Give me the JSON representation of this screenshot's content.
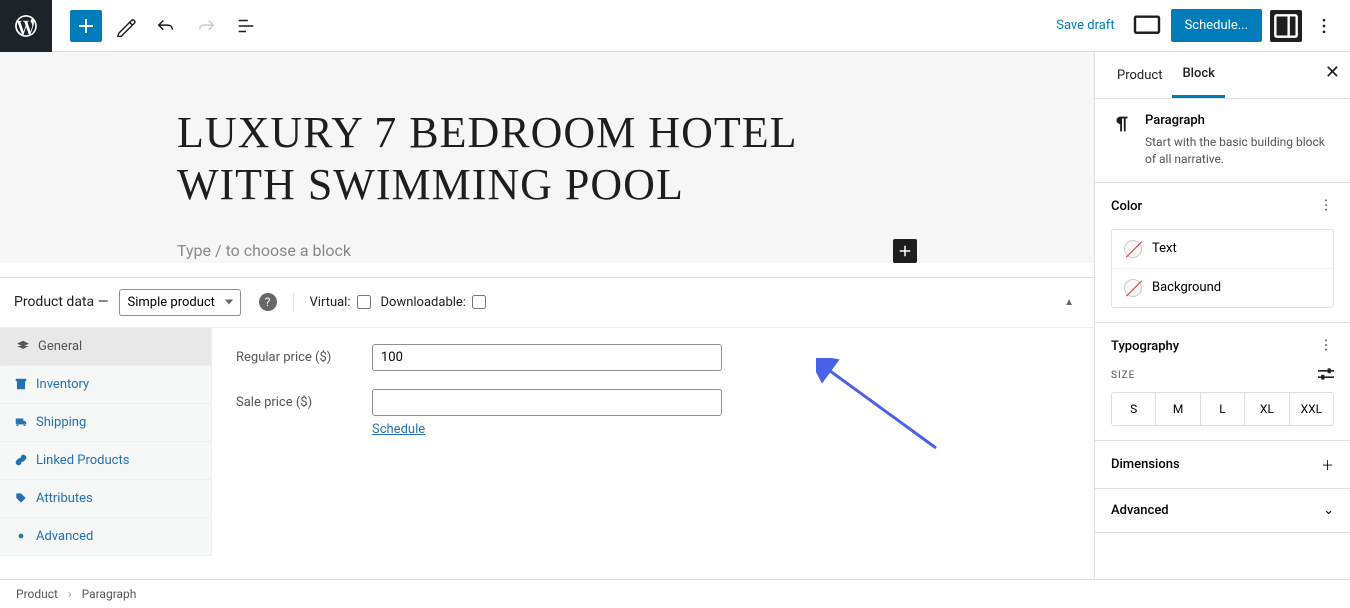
{
  "topbar": {
    "save_draft": "Save draft",
    "schedule": "Schedule..."
  },
  "editor": {
    "title": "LUXURY 7 BEDROOM HOTEL WITH SWIMMING POOL",
    "paragraph_placeholder": "Type / to choose a block"
  },
  "product_data": {
    "label": "Product data —",
    "select_value": "Simple product",
    "virtual_label": "Virtual:",
    "downloadable_label": "Downloadable:",
    "tabs": [
      "General",
      "Inventory",
      "Shipping",
      "Linked Products",
      "Attributes",
      "Advanced"
    ],
    "regular_price_label": "Regular price ($)",
    "regular_price_value": "100",
    "sale_price_label": "Sale price ($)",
    "sale_price_value": "",
    "schedule_link": "Schedule"
  },
  "sidebar": {
    "tabs": [
      "Product",
      "Block"
    ],
    "block_name": "Paragraph",
    "block_desc": "Start with the basic building block of all narrative.",
    "color_title": "Color",
    "color_text": "Text",
    "color_bg": "Background",
    "typography_title": "Typography",
    "size_label": "SIZE",
    "sizes": [
      "S",
      "M",
      "L",
      "XL",
      "XXL"
    ],
    "dimensions": "Dimensions",
    "advanced": "Advanced"
  },
  "breadcrumb": {
    "root": "Product",
    "leaf": "Paragraph"
  }
}
